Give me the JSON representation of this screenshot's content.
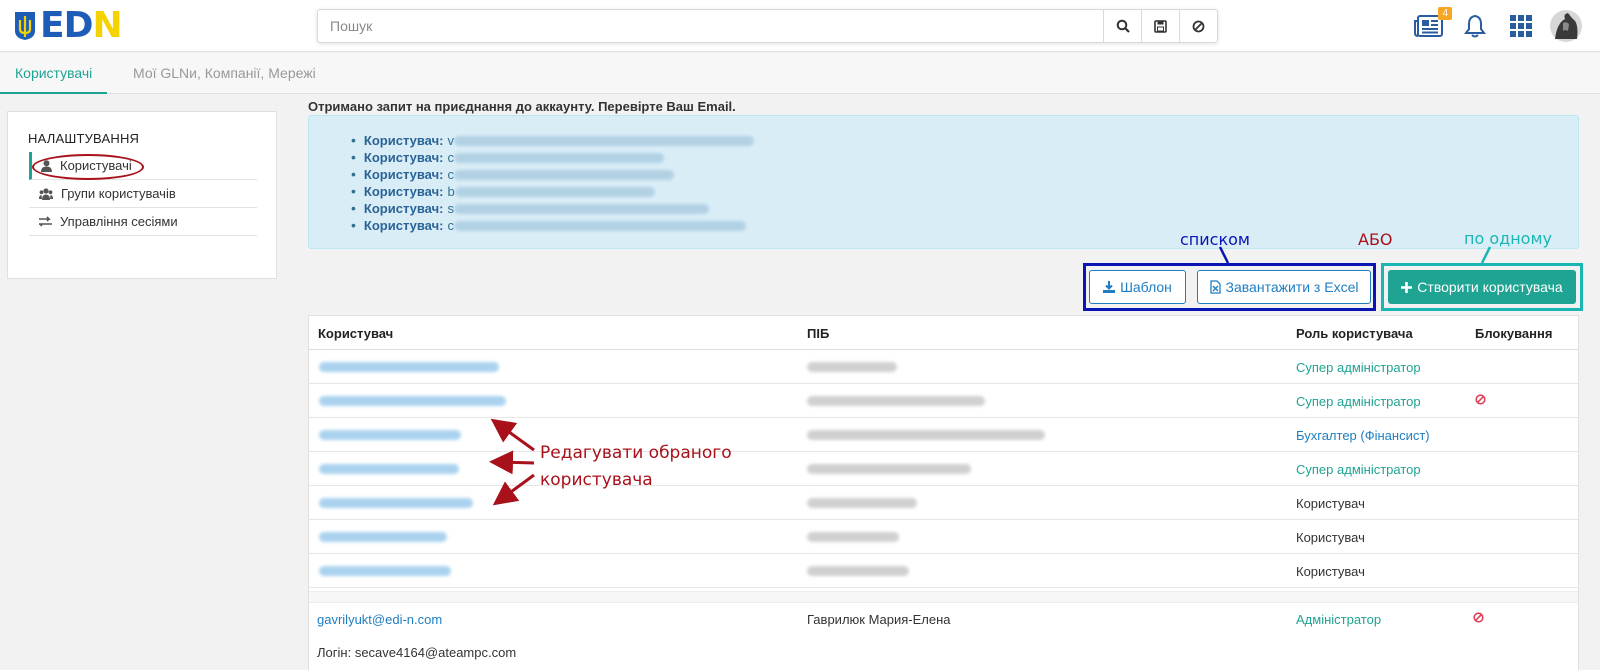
{
  "header": {
    "logo_letters": [
      "E",
      "D",
      "N"
    ],
    "search_placeholder": "Пошук",
    "news_badge": "4",
    "icons": [
      "search-icon",
      "save-icon",
      "clear-icon",
      "news-icon",
      "bell-icon",
      "apps-grid-icon",
      "avatar"
    ]
  },
  "tabs": [
    {
      "label": "Користувачі",
      "active": true
    },
    {
      "label": "Мої GLNи, Компанії, Мережі",
      "active": false
    }
  ],
  "sidebar": {
    "title": "НАЛАШТУВАННЯ",
    "items": [
      {
        "label": "Користувачі",
        "icon": "user-icon",
        "active": true
      },
      {
        "label": "Групи користувачів",
        "icon": "users-icon",
        "active": false
      },
      {
        "label": "Управління сесіями",
        "icon": "exchange-icon",
        "active": false
      }
    ]
  },
  "notice": {
    "title": "Отримано запит на приєднання до аккаунту. Перевірте Ваш Email.",
    "item_label": "Користувач:",
    "item_prefixes": [
      "v",
      "c",
      "c",
      "b",
      "s",
      "c"
    ]
  },
  "annotations": {
    "list_label": "списком",
    "or_label": "АБО",
    "single_label": "по одному",
    "edit_hint_line1": "Редагувати обраного",
    "edit_hint_line2": "користувача"
  },
  "actions": {
    "template_label": "Шаблон",
    "excel_label": "Завантажити з Excel",
    "create_label": "Створити користувача"
  },
  "table": {
    "columns": [
      "Користувач",
      "ПІБ",
      "Роль користувача",
      "Блокування"
    ],
    "rows": [
      {
        "role": "Супер адміністратор",
        "role_color": "#1fa392",
        "blocked": false
      },
      {
        "role": "Супер адміністратор",
        "role_color": "#1fa392",
        "blocked": true
      },
      {
        "role": "Бухгалтер (Фінансист)",
        "role_color": "#1f7ec2",
        "blocked": false
      },
      {
        "role": "Супер адміністратор",
        "role_color": "#1fa392",
        "blocked": false
      },
      {
        "role": "Користувач",
        "role_color": "#333333",
        "blocked": false
      },
      {
        "role": "Користувач",
        "role_color": "#333333",
        "blocked": false
      },
      {
        "role": "Користувач",
        "role_color": "#333333",
        "blocked": false
      }
    ],
    "last_row": {
      "email": "gavrilyukt@edi-n.com",
      "fio": "Гаврилюк Мария-Елена",
      "role": "Адміністратор",
      "blocked": true,
      "login_label": "Логін:",
      "login": "secave4164@ateampc.com"
    }
  },
  "colors": {
    "accent": "#1fa392",
    "link": "#1f7ec2",
    "annotation_red": "#a8101a",
    "annotation_blue": "#0b14b5",
    "annotation_teal": "#1ab6b3"
  }
}
